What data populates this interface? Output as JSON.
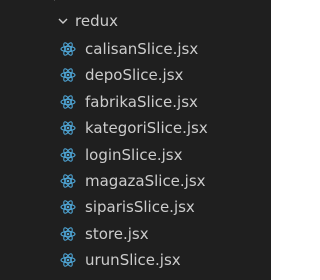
{
  "explorer": {
    "parent_partial": {
      "label": ""
    },
    "folder": {
      "label": "redux",
      "expanded": true,
      "icon": "chevron-down-icon"
    },
    "files": [
      {
        "label": "calisanSlice.jsx",
        "icon": "react-icon"
      },
      {
        "label": "depoSlice.jsx",
        "icon": "react-icon"
      },
      {
        "label": "fabrikaSlice.jsx",
        "icon": "react-icon"
      },
      {
        "label": "kategoriSlice.jsx",
        "icon": "react-icon"
      },
      {
        "label": "loginSlice.jsx",
        "icon": "react-icon"
      },
      {
        "label": "magazaSlice.jsx",
        "icon": "react-icon"
      },
      {
        "label": "siparisSlice.jsx",
        "icon": "react-icon"
      },
      {
        "label": "store.jsx",
        "icon": "react-icon"
      },
      {
        "label": "urunSlice.jsx",
        "icon": "react-icon"
      }
    ],
    "colors": {
      "background": "#1f1f1f",
      "text": "#cccccc",
      "react_icon": "#4fa6d6"
    }
  }
}
